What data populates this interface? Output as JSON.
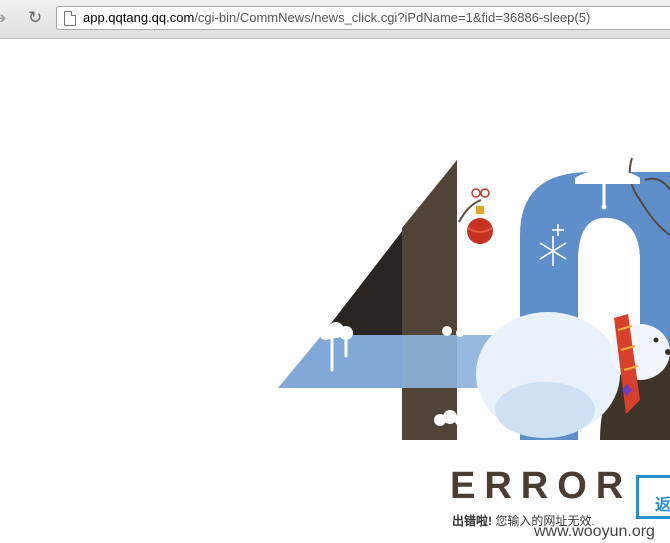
{
  "browser": {
    "url_host": "app.qqtang.qq.com",
    "url_path": "/cgi-bin/CommNews/news_click.cgi?iPdName=1&fid=36886-sleep(5)"
  },
  "page": {
    "error_title": "ERROR",
    "error_prefix": "出错啦!",
    "error_message": "您输入的网址无效.",
    "return_label": "返"
  },
  "watermark": "www.wooyun.org",
  "colors": {
    "brown": "#4f4437",
    "blue": "#5f8fca",
    "light_blue": "#a9c6e6",
    "link_blue": "#2a8fd0"
  }
}
